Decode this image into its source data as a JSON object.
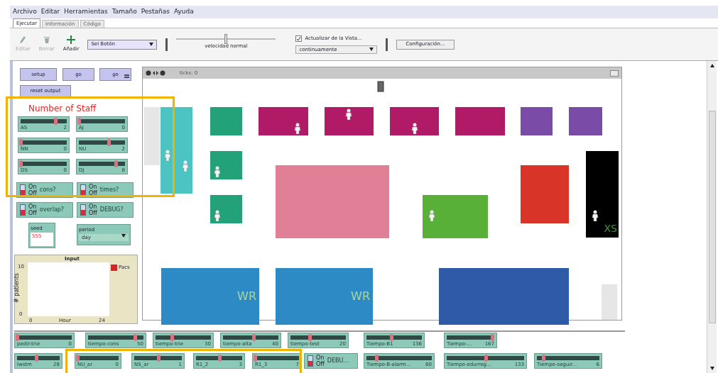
{
  "menu": [
    "Archivo",
    "Editar",
    "Herramientas",
    "Tamaño",
    "Pestañas",
    "Ayuda"
  ],
  "tabs": [
    {
      "label": "Ejecutar",
      "selected": true
    },
    {
      "label": "Información",
      "selected": false
    },
    {
      "label": "Código",
      "selected": false
    }
  ],
  "toolbar": {
    "tools": [
      {
        "kind": "edit",
        "label": "Editar",
        "disabled": true
      },
      {
        "kind": "delete",
        "label": "Borrar",
        "disabled": true
      },
      {
        "kind": "add",
        "label": "Añadir",
        "disabled": false
      }
    ],
    "widget_select": "Sel Botón",
    "speed": {
      "label": "velocidad normal",
      "level": 0.5
    },
    "update_view": {
      "label": "Actualizar de la Vista...",
      "checked": true
    },
    "update_mode": "continuamente",
    "settings_button": "Configuración..."
  },
  "buttons": [
    {
      "label": "setup",
      "forever": false
    },
    {
      "label": "go",
      "forever": false
    },
    {
      "label": "go",
      "forever": true
    },
    {
      "label": "reset output",
      "forever": false
    }
  ],
  "heading": "Number of Staff",
  "staff_sliders": [
    {
      "label": "AS",
      "value": "2",
      "level": 0.75
    },
    {
      "label": "AJ",
      "value": "0",
      "level": 0.0
    },
    {
      "label": "NN",
      "value": "0",
      "level": 0.0
    },
    {
      "label": "NU",
      "value": "2",
      "level": 0.65
    },
    {
      "label": "DS",
      "value": "0",
      "level": 0.0
    },
    {
      "label": "DJ",
      "value": "8",
      "level": 0.8
    }
  ],
  "switches": [
    {
      "label": "cons?",
      "on_text": "On",
      "off_text": "Off",
      "on": false
    },
    {
      "label": "times?",
      "on_text": "On",
      "off_text": "Off",
      "on": false
    },
    {
      "label": "overlap?",
      "on_text": "On",
      "off_text": "Off",
      "on": false
    },
    {
      "label": "DEBUG?",
      "on_text": "On",
      "off_text": "Off",
      "on": false
    }
  ],
  "seed": {
    "label": "seed",
    "value": "555"
  },
  "period": {
    "label": "period",
    "value": "day"
  },
  "plot": {
    "title": "Input",
    "ylabel": "# patients",
    "xlabel": "Hour",
    "x_min": "0",
    "x_max": "24",
    "y_min": "0",
    "y_max": "10",
    "legend": [
      {
        "label": "Pacs",
        "color": "#d02828"
      }
    ]
  },
  "world": {
    "title": "ticks: 0",
    "patches": [
      {
        "color": "#4cc4c4"
      },
      {
        "color": "#23a27a"
      },
      {
        "color": "#b01a66"
      },
      {
        "color": "#b01a66"
      },
      {
        "color": "#b01a66"
      },
      {
        "color": "#b01a66"
      },
      {
        "color": "#7a4ca8"
      },
      {
        "color": "#7a4ca8"
      },
      {
        "color": "#23a27a"
      },
      {
        "color": "#23a27a"
      },
      {
        "color": "#e07f96"
      },
      {
        "color": "#58b038"
      },
      {
        "color": "#d83428"
      },
      {
        "color": "#000000",
        "label": "XS"
      },
      {
        "color": "#2d8ac4",
        "label": "WR"
      },
      {
        "color": "#2d8ac4",
        "label": "WR"
      },
      {
        "color": "#2f5aa8"
      }
    ]
  },
  "bottom_sliders": [
    {
      "label": "pedir-trie",
      "value": "0",
      "level": 0.0
    },
    {
      "label": "tiempo-cons",
      "value": "50",
      "level": 0.85
    },
    {
      "label": "tiempo-trie",
      "value": "30",
      "level": 0.3
    },
    {
      "label": "tiempo-alta",
      "value": "40",
      "level": 0.55
    },
    {
      "label": "tiempo-test",
      "value": "20",
      "level": 0.35
    },
    {
      "label": "Tiempo-B1",
      "value": "136",
      "level": 0.45
    },
    {
      "label": "Tiempo-...",
      "value": "167",
      "level": 0.95
    },
    {
      "label": "lwstm",
      "value": "28",
      "level": 0.45
    },
    {
      "label": "NU_ar",
      "value": "0",
      "level": 0.0
    },
    {
      "label": "NS_ar",
      "value": "1",
      "level": 0.5
    },
    {
      "label": "R1_2",
      "value": "3",
      "level": 0.5
    },
    {
      "label": "R1_3",
      "value": "7",
      "level": 0.0
    },
    {
      "label": "Tiempo-B-alarm...",
      "value": "80",
      "level": 0.15
    },
    {
      "label": "Tiempo-edurreg...",
      "value": "133",
      "level": 0.5
    },
    {
      "label": "Tiempo-seguir...",
      "value": "6",
      "level": 0.1
    }
  ],
  "bottom_switch": {
    "label": "DEBU...",
    "on_text": "On",
    "off_text": "Off",
    "on": false
  }
}
